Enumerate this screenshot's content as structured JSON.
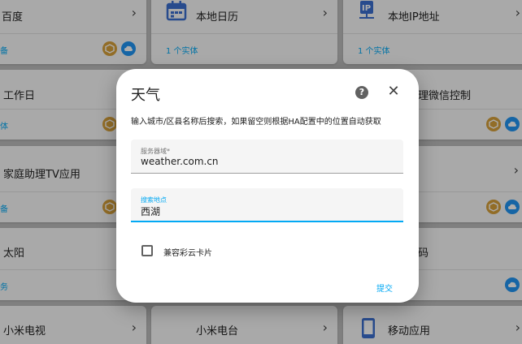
{
  "cards": [
    {
      "title": "百度",
      "count": "备"
    },
    {
      "title": "本地日历",
      "count": "1 个实体"
    },
    {
      "title": "本地IP地址",
      "count": "1 个实体"
    },
    {
      "title": "工作日",
      "count": "体"
    },
    {
      "title": "理微信控制",
      "count": ""
    },
    {
      "title": "家庭助理TV应用",
      "count": "备"
    },
    {
      "title": "太阳",
      "count": "务"
    },
    {
      "title": "码",
      "count": ""
    },
    {
      "title": "小米电视"
    },
    {
      "title": "小米电台"
    },
    {
      "title": "移动应用"
    }
  ],
  "chevron": "›",
  "dialog": {
    "title": "天气",
    "description": "输入城市/区县名称后搜索，如果留空则根据HA配置中的位置自动获取",
    "server_field": {
      "label": "服务器域*",
      "value": "weather.com.cn"
    },
    "location_field": {
      "label": "搜索地点",
      "value": "西湖"
    },
    "checkbox_label": "兼容彩云卡片",
    "submit_label": "提交",
    "help_glyph": "?",
    "close_glyph": "✕"
  },
  "colors": {
    "accent": "#03a9f4",
    "badge_gold": "#d8a13a",
    "badge_blue": "#2196f3"
  }
}
